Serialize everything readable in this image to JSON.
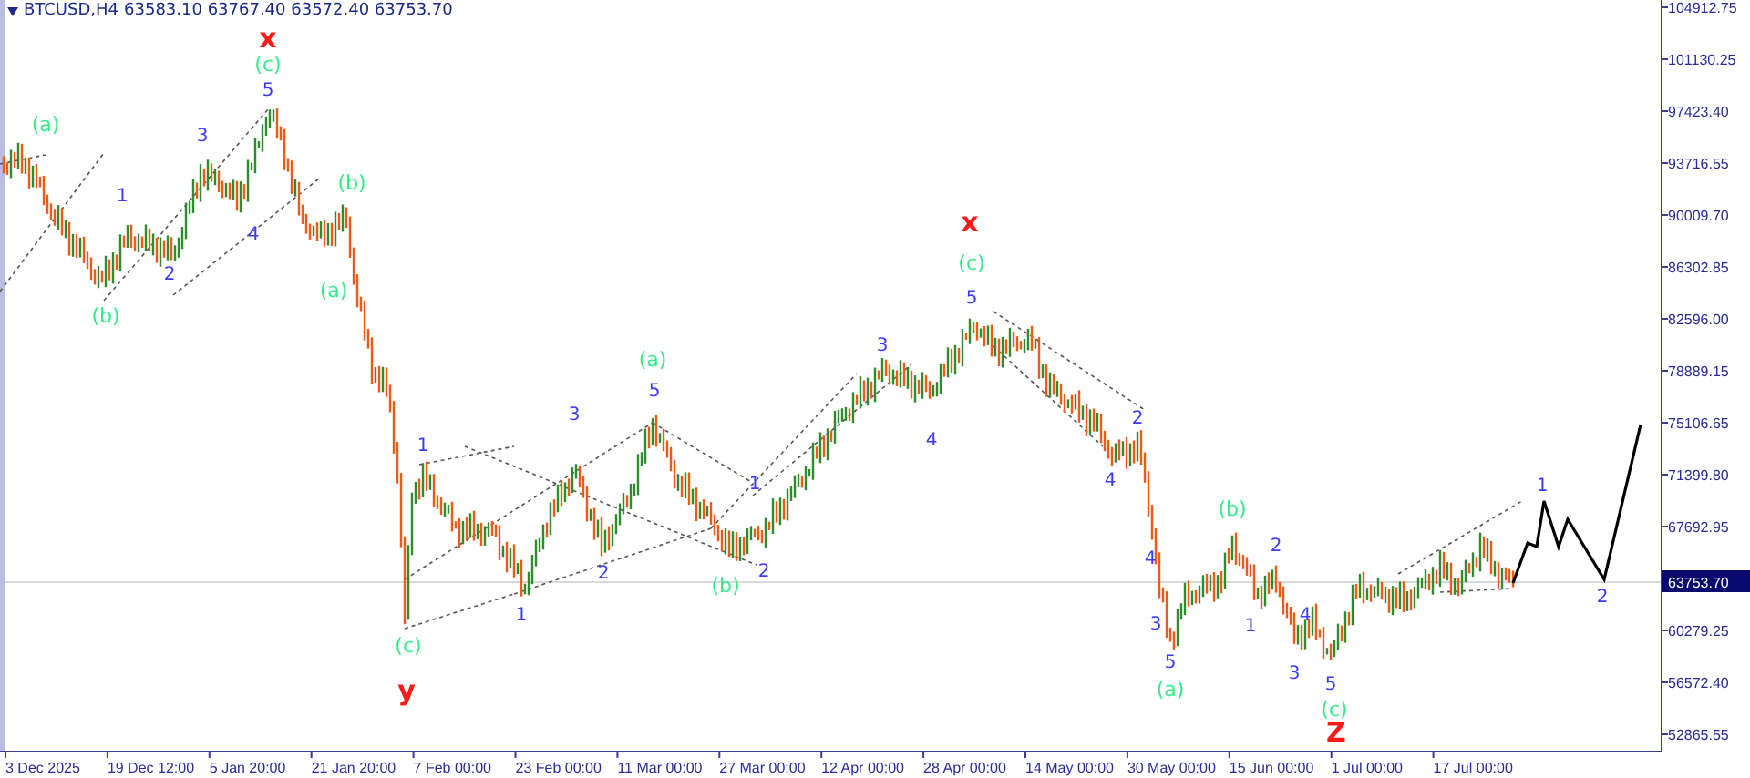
{
  "chart": {
    "symbol": "BTCUSD,H4",
    "ohlc": [
      "63583.10",
      "63767.40",
      "63572.40",
      "63753.70"
    ],
    "price_axis": [
      "104912.75",
      "101130.25",
      "97423.40",
      "93716.55",
      "90009.70",
      "86302.85",
      "82596.00",
      "78889.15",
      "75106.65",
      "71399.80",
      "67692.95",
      "60279.25",
      "56572.40",
      "52865.55"
    ],
    "current_price": "63753.70",
    "time_axis": [
      "3 Dec 2025",
      "19 Dec 12:00",
      "5 Jan 20:00",
      "21 Jan 20:00",
      "7 Feb 00:00",
      "23 Feb 00:00",
      "11 Mar 00:00",
      "27 Mar 00:00",
      "12 Apr 00:00",
      "28 Apr 00:00",
      "14 May 00:00",
      "30 May 00:00",
      "15 Jun 00:00",
      "1 Jul 00:00",
      "17 Jul 00:00"
    ],
    "wave_labels": [
      {
        "text": "x",
        "kind": "primary"
      },
      {
        "text": "(c)",
        "kind": "intermediate"
      },
      {
        "text": "5",
        "kind": "minor"
      },
      {
        "text": "(a)",
        "kind": "intermediate"
      },
      {
        "text": "3",
        "kind": "minor"
      },
      {
        "text": "(b)",
        "kind": "intermediate"
      },
      {
        "text": "1",
        "kind": "minor"
      },
      {
        "text": "4",
        "kind": "minor"
      },
      {
        "text": "2",
        "kind": "minor"
      },
      {
        "text": "(a)",
        "kind": "intermediate"
      },
      {
        "text": "(b)",
        "kind": "intermediate"
      },
      {
        "text": "x",
        "kind": "primary"
      },
      {
        "text": "(c)",
        "kind": "intermediate"
      },
      {
        "text": "5",
        "kind": "minor"
      },
      {
        "text": "3",
        "kind": "minor"
      },
      {
        "text": "(a)",
        "kind": "intermediate"
      },
      {
        "text": "5",
        "kind": "minor"
      },
      {
        "text": "3",
        "kind": "minor"
      },
      {
        "text": "1",
        "kind": "minor"
      },
      {
        "text": "4",
        "kind": "minor"
      },
      {
        "text": "2",
        "kind": "minor"
      },
      {
        "text": "1",
        "kind": "minor"
      },
      {
        "text": "4",
        "kind": "minor"
      },
      {
        "text": "2",
        "kind": "minor"
      },
      {
        "text": "1",
        "kind": "minor"
      },
      {
        "text": "(b)",
        "kind": "intermediate"
      },
      {
        "text": "2",
        "kind": "minor"
      },
      {
        "text": "(b)",
        "kind": "intermediate"
      },
      {
        "text": "2",
        "kind": "minor"
      },
      {
        "text": "1",
        "kind": "minor"
      },
      {
        "text": "4",
        "kind": "minor"
      },
      {
        "text": "3",
        "kind": "minor"
      },
      {
        "text": "5",
        "kind": "minor"
      },
      {
        "text": "4",
        "kind": "minor"
      },
      {
        "text": "3",
        "kind": "minor"
      },
      {
        "text": "5",
        "kind": "minor"
      },
      {
        "text": "1",
        "kind": "minor"
      },
      {
        "text": "2",
        "kind": "minor"
      },
      {
        "text": "(c)",
        "kind": "intermediate"
      },
      {
        "text": "y",
        "kind": "primary"
      },
      {
        "text": "(a)",
        "kind": "intermediate"
      },
      {
        "text": "(c)",
        "kind": "intermediate"
      },
      {
        "text": "Z",
        "kind": "primary"
      }
    ]
  }
}
